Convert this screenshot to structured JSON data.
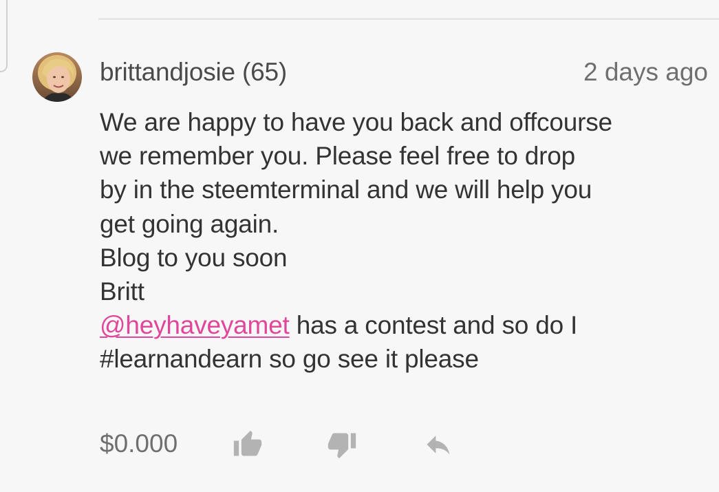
{
  "comment": {
    "author": "brittandjosie (65)",
    "timestamp": "2 days ago",
    "body_lines": [
      "We are happy to have you back and offcourse",
      "we remember you. Please feel free to drop",
      "by in the steemterminal and we will help you",
      "get going again.",
      "Blog to you soon",
      "Britt"
    ],
    "mention": "@heyhaveyamet",
    "mention_rest": " has a contest and so do I",
    "last_line": "#learnandearn so go see it please"
  },
  "footer": {
    "payout": "$0.000",
    "upvote_icon": "thumbs-up-icon",
    "downvote_icon": "thumbs-down-icon",
    "reply_icon": "reply-arrow-icon"
  },
  "colors": {
    "background": "#f7f7f7",
    "text": "#333333",
    "muted": "#6f6f6f",
    "mention": "#e0479b",
    "icon": "#b3b3b3"
  }
}
